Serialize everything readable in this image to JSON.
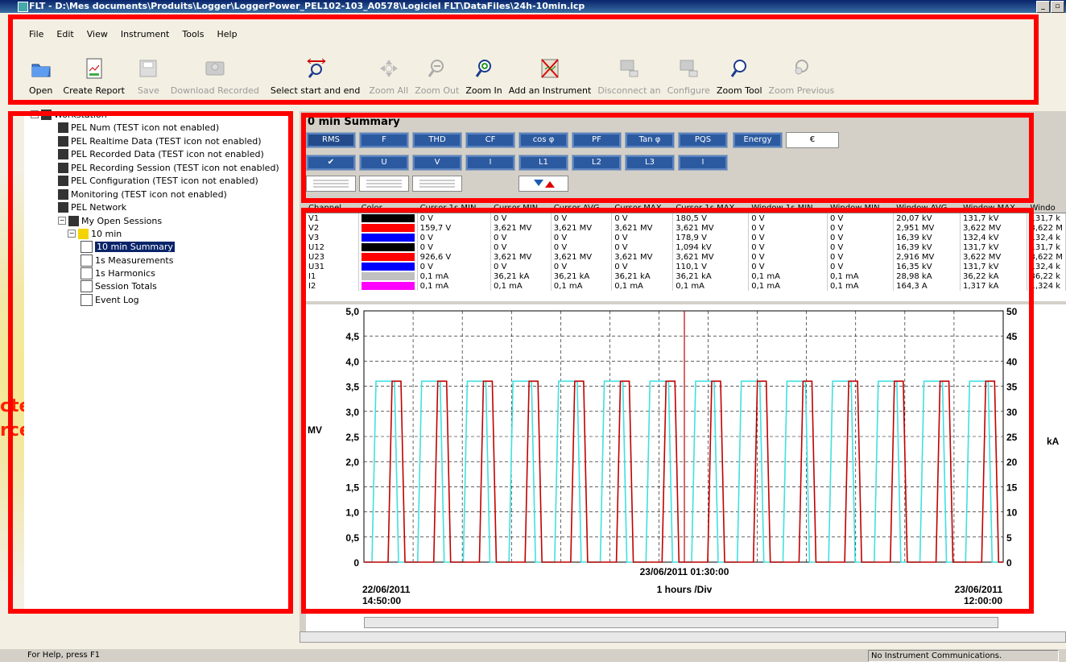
{
  "window": {
    "title": "FLT - D:\\Mes documents\\Produits\\Logger\\LoggerPower_PEL102-103_A0578\\Logiciel FLT\\DataFiles\\24h-10min.icp"
  },
  "menu": [
    "File",
    "Edit",
    "View",
    "Instrument",
    "Tools",
    "Help"
  ],
  "toolbar": [
    {
      "label": "Open",
      "icon": "folder-icon",
      "enabled": true
    },
    {
      "label": "Create Report",
      "icon": "report-icon",
      "enabled": true
    },
    {
      "label": "Save",
      "icon": "save-icon",
      "enabled": false
    },
    {
      "label": "Download Recorded",
      "icon": "download-icon",
      "enabled": false
    },
    {
      "label": "Select start and end",
      "icon": "select-range-icon",
      "enabled": true
    },
    {
      "label": "Zoom All",
      "icon": "zoom-all-icon",
      "enabled": false
    },
    {
      "label": "Zoom Out",
      "icon": "zoom-out-icon",
      "enabled": false
    },
    {
      "label": "Zoom In",
      "icon": "zoom-in-icon",
      "enabled": true
    },
    {
      "label": "Add an Instrument",
      "icon": "add-instrument-icon",
      "enabled": true
    },
    {
      "label": "Disconnect an",
      "icon": "disconnect-icon",
      "enabled": false
    },
    {
      "label": "Configure",
      "icon": "configure-icon",
      "enabled": false
    },
    {
      "label": "Zoom Tool",
      "icon": "zoom-tool-icon",
      "enabled": true
    },
    {
      "label": "Zoom Previous",
      "icon": "zoom-previous-icon",
      "enabled": false
    }
  ],
  "tree": [
    {
      "label": "Workstation",
      "level": 0
    },
    {
      "label": "PEL Num (TEST icon not enabled)",
      "level": 1
    },
    {
      "label": "PEL Realtime Data (TEST icon not enabled)",
      "level": 1
    },
    {
      "label": "PEL Recorded Data (TEST icon not enabled)",
      "level": 1
    },
    {
      "label": "PEL Recording Session (TEST icon not enabled)",
      "level": 1
    },
    {
      "label": "PEL Configuration (TEST icon not enabled)",
      "level": 1
    },
    {
      "label": "Monitoring (TEST icon not enabled)",
      "level": 1
    },
    {
      "label": "PEL Network",
      "level": 1
    },
    {
      "label": "My Open Sessions",
      "level": 1
    },
    {
      "label": "10 min",
      "level": 2
    },
    {
      "label": "10 min Summary",
      "level": 3,
      "selected": true
    },
    {
      "label": "1s Measurements",
      "level": 3
    },
    {
      "label": "1s Harmonics",
      "level": 3
    },
    {
      "label": "Session Totals",
      "level": 3
    },
    {
      "label": "Event Log",
      "level": 3
    }
  ],
  "side_text": [
    "ctés",
    "rces"
  ],
  "summary_title": "0 min Summary",
  "param_buttons_row1": [
    "RMS",
    "F",
    "THD",
    "CF",
    "cos φ",
    "PF",
    "Tan φ",
    "PQS",
    "Energy",
    "€"
  ],
  "param_buttons_row2": [
    "✔",
    "U",
    "V",
    "I",
    "L1",
    "L2",
    "L3",
    "I"
  ],
  "table": {
    "headers": [
      "Channel",
      "Color",
      "Cursor 1s MIN",
      "Cursor MIN",
      "Cursor AVG",
      "Cursor MAX",
      "Cursor 1s MAX",
      "Window 1s MIN",
      "Window MIN",
      "Window AVG",
      "Window MAX",
      "Windo"
    ],
    "rows": [
      {
        "ch": "V1",
        "color": "#000000",
        "vals": [
          "0 V",
          "0 V",
          "0 V",
          "0 V",
          "180,5 V",
          "0 V",
          "0 V",
          "20,07 kV",
          "131,7 kV",
          "131,7 k"
        ]
      },
      {
        "ch": "V2",
        "color": "#ff0000",
        "vals": [
          "159,7 V",
          "3,621 MV",
          "3,621 MV",
          "3,621 MV",
          "3,621 MV",
          "0 V",
          "0 V",
          "2,951 MV",
          "3,622 MV",
          "3,622 M"
        ]
      },
      {
        "ch": "V3",
        "color": "#0000ff",
        "vals": [
          "0 V",
          "0 V",
          "0 V",
          "0 V",
          "178,9 V",
          "0 V",
          "0 V",
          "16,39 kV",
          "132,4 kV",
          "132,4 k"
        ]
      },
      {
        "ch": "U12",
        "color": "#000000",
        "vals": [
          "0 V",
          "0 V",
          "0 V",
          "0 V",
          "1,094 kV",
          "0 V",
          "0 V",
          "16,39 kV",
          "131,7 kV",
          "131,7 k"
        ]
      },
      {
        "ch": "U23",
        "color": "#ff0000",
        "vals": [
          "926,6 V",
          "3,621 MV",
          "3,621 MV",
          "3,621 MV",
          "3,621 MV",
          "0 V",
          "0 V",
          "2,916 MV",
          "3,622 MV",
          "3,622 M"
        ]
      },
      {
        "ch": "U31",
        "color": "#0000ff",
        "vals": [
          "0 V",
          "0 V",
          "0 V",
          "0 V",
          "110,1 V",
          "0 V",
          "0 V",
          "16,35 kV",
          "131,7 kV",
          "132,4 k"
        ]
      },
      {
        "ch": "I1",
        "color": "#c0c0c0",
        "vals": [
          "0,1 mA",
          "36,21 kA",
          "36,21 kA",
          "36,21 kA",
          "36,21 kA",
          "0,1 mA",
          "0,1 mA",
          "28,98 kA",
          "36,22 kA",
          "36,22 k"
        ]
      },
      {
        "ch": "I2",
        "color": "#ff00ff",
        "vals": [
          "0,1 mA",
          "0,1 mA",
          "0,1 mA",
          "0,1 mA",
          "0,1 mA",
          "0,1 mA",
          "0,1 mA",
          "164,3 A",
          "1,317 kA",
          "1,324 k"
        ]
      }
    ]
  },
  "chart_data": {
    "type": "line",
    "left_unit": "MV",
    "right_unit": "kA",
    "left_ticks": [
      "0",
      "0,5",
      "1,0",
      "1,5",
      "2,0",
      "2,5",
      "3,0",
      "3,5",
      "4,0",
      "4,5",
      "5,0"
    ],
    "right_ticks": [
      "0",
      "5",
      "10",
      "15",
      "20",
      "25",
      "30",
      "35",
      "40",
      "45",
      "50"
    ],
    "ylim_left": [
      0,
      5.0
    ],
    "ylim_right": [
      0,
      50
    ],
    "cursor_label": "23/06/2011 01:30:00",
    "start_date": "22/06/2011",
    "start_time": "14:50:00",
    "end_date": "23/06/2011",
    "end_time": "12:00:00",
    "division_label": "1 hours /Div",
    "grid": true,
    "series": [
      {
        "color": "#40e0e0",
        "pulse_level": 3.6
      },
      {
        "color": "#c00000",
        "pulse_level": 3.6
      }
    ]
  },
  "status": {
    "help": "For Help, press F1",
    "comm": "No Instrument Communications."
  }
}
